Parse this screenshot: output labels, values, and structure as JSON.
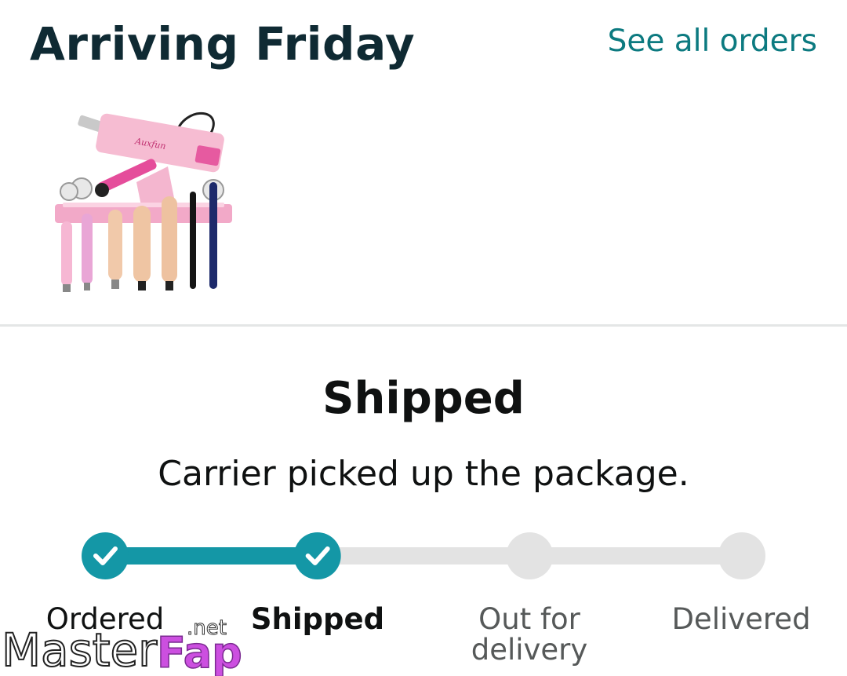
{
  "header": {
    "title": "Arriving Friday",
    "see_all_label": "See all orders"
  },
  "product": {
    "image_icon": "product-thumbnail-icon",
    "brand_mark": "Auxfun"
  },
  "status": {
    "title": "Shipped",
    "subtitle": "Carrier picked up the package."
  },
  "tracker": {
    "progress": 0.37,
    "accent_color": "#1497a6",
    "inactive_color": "#e3e3e3",
    "steps": [
      {
        "label": "Ordered",
        "state": "done"
      },
      {
        "label": "Shipped",
        "state": "current"
      },
      {
        "label": "Out for delivery",
        "state": "pending"
      },
      {
        "label": "Delivered",
        "state": "pending"
      }
    ]
  },
  "watermark": {
    "text_main": "Master",
    "text_accent": "Fap",
    "text_suffix": ".net"
  }
}
